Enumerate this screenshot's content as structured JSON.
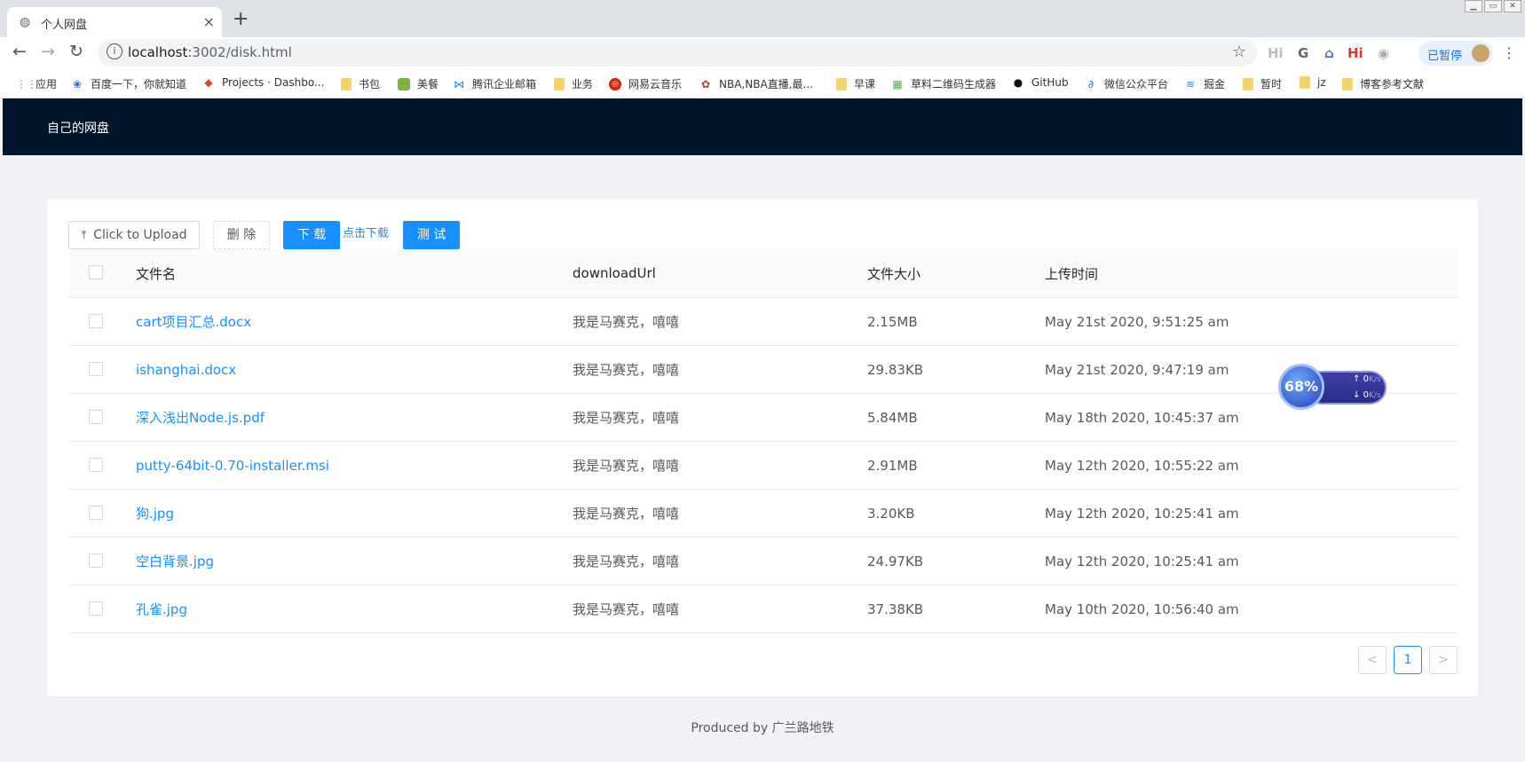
{
  "browser": {
    "tab_title": "个人网盘",
    "tab_close": "×",
    "new_tab": "+",
    "url_host": "localhost",
    "url_path": ":3002/disk.html",
    "paused_label": "已暂停",
    "extensions": [
      "Hi",
      "G",
      "Hi"
    ]
  },
  "bookmarks": [
    {
      "label": "应用",
      "icon": "apps-grid-icon"
    },
    {
      "label": "百度一下，你就知道",
      "icon": "baidu-paw-icon"
    },
    {
      "label": "Projects · Dashbo...",
      "icon": "gitlab-fox-icon"
    },
    {
      "label": "书包",
      "icon": "folder-icon"
    },
    {
      "label": "美餐",
      "icon": "meican-icon"
    },
    {
      "label": "腾讯企业邮箱",
      "icon": "tencent-mail-icon"
    },
    {
      "label": "业务",
      "icon": "folder-icon"
    },
    {
      "label": "网易云音乐",
      "icon": "netease-music-icon"
    },
    {
      "label": "NBA,NBA直播,最...",
      "icon": "nba-icon"
    },
    {
      "label": "早课",
      "icon": "folder-icon"
    },
    {
      "label": "草料二维码生成器",
      "icon": "qrcode-icon"
    },
    {
      "label": "GitHub",
      "icon": "github-icon"
    },
    {
      "label": "微信公众平台",
      "icon": "wechat-mp-icon"
    },
    {
      "label": "掘金",
      "icon": "juejin-icon"
    },
    {
      "label": "暂时",
      "icon": "folder-icon"
    },
    {
      "label": "jz",
      "icon": "folder-icon"
    },
    {
      "label": "博客参考文献",
      "icon": "folder-icon"
    }
  ],
  "header": {
    "brand": "自己的网盘"
  },
  "toolbar": {
    "upload_label": "Click to Upload",
    "delete_label": "删 除",
    "download_label": "下 载",
    "click_download_label": "点击下载",
    "test_label": "测 试"
  },
  "table": {
    "columns": [
      "文件名",
      "downloadUrl",
      "文件大小",
      "上传时间"
    ],
    "rows": [
      {
        "name": "cart项目汇总.docx",
        "url": "我是马赛克，嘻嘻",
        "size": "2.15MB",
        "time": "May 21st 2020, 9:51:25 am"
      },
      {
        "name": "ishanghai.docx",
        "url": "我是马赛克，嘻嘻",
        "size": "29.83KB",
        "time": "May 21st 2020, 9:47:19 am"
      },
      {
        "name": "深入浅出Node.js.pdf",
        "url": "我是马赛克，嘻嘻",
        "size": "5.84MB",
        "time": "May 18th 2020, 10:45:37 am"
      },
      {
        "name": "putty-64bit-0.70-installer.msi",
        "url": "我是马赛克，嘻嘻",
        "size": "2.91MB",
        "time": "May 12th 2020, 10:55:22 am"
      },
      {
        "name": "狗.jpg",
        "url": "我是马赛克，嘻嘻",
        "size": "3.20KB",
        "time": "May 12th 2020, 10:25:41 am"
      },
      {
        "name": "空白背景.jpg",
        "url": "我是马赛克，嘻嘻",
        "size": "24.97KB",
        "time": "May 12th 2020, 10:25:41 am"
      },
      {
        "name": "孔雀.jpg",
        "url": "我是马赛克，嘻嘻",
        "size": "37.38KB",
        "time": "May 10th 2020, 10:56:40 am"
      }
    ]
  },
  "pagination": {
    "prev": "<",
    "current": "1",
    "next": ">"
  },
  "footer": {
    "text": "Produced by 广兰路地铁"
  },
  "speed_widget": {
    "percent": "68%",
    "up": "0",
    "down": "0",
    "unit": "K/s"
  },
  "colors": {
    "header_bg": "#001529",
    "primary": "#1890ff"
  }
}
